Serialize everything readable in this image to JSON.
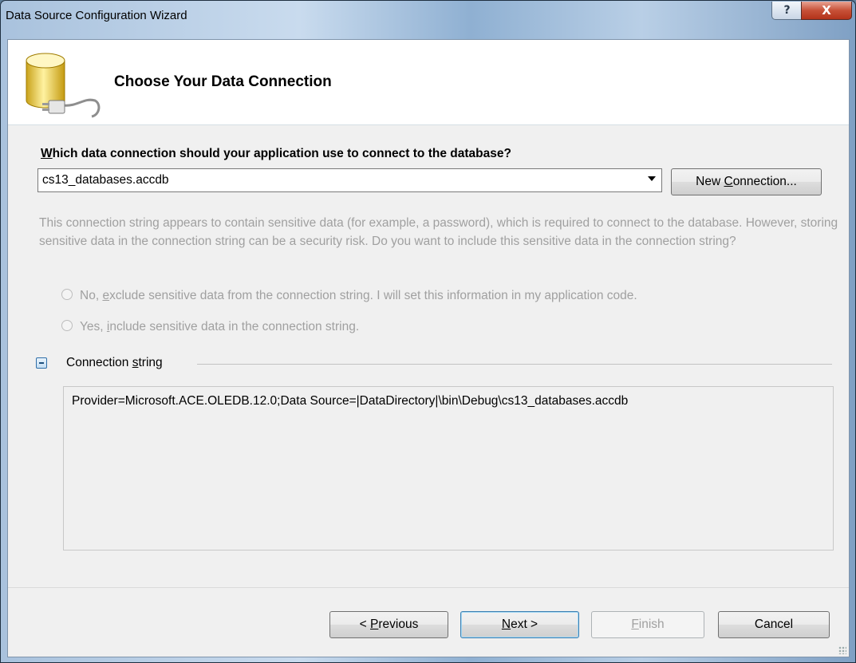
{
  "window": {
    "title": "Data Source Configuration Wizard",
    "help_glyph": "?",
    "close_glyph": "X"
  },
  "header": {
    "title": "Choose Your Data Connection",
    "icon": "database-plug-icon"
  },
  "question": {
    "mnemonic": "W",
    "rest": "hich data connection should your application use to connect to the database?"
  },
  "connection_select": {
    "value": "cs13_databases.accdb"
  },
  "new_connection_button": {
    "before": "New ",
    "mnemonic": "C",
    "after": "onnection..."
  },
  "sensitive_notice": "This connection string appears to contain sensitive data (for example, a password), which is required to connect to the database. However, storing sensitive data in the connection string can be a security risk. Do you want to include this sensitive data in the connection string?",
  "radio_exclude": {
    "before": "No, ",
    "mnemonic": "e",
    "after": "xclude sensitive data from the connection string. I will set this information in my application code."
  },
  "radio_include": {
    "before": "Yes, ",
    "mnemonic": "i",
    "after": "nclude sensitive data in the connection string."
  },
  "connection_string_section": {
    "label_before": "Connection ",
    "mnemonic": "s",
    "label_after": "tring",
    "value": "Provider=Microsoft.ACE.OLEDB.12.0;Data Source=|DataDirectory|\\bin\\Debug\\cs13_databases.accdb"
  },
  "buttons": {
    "previous": {
      "before": "< ",
      "mnemonic": "P",
      "after": "revious"
    },
    "next": {
      "before": "",
      "mnemonic": "N",
      "after": "ext >"
    },
    "finish": {
      "before": "",
      "mnemonic": "F",
      "after": "inish"
    },
    "cancel": "Cancel"
  },
  "colors": {
    "disabled_text": "#a0a0a0",
    "header_background": "#ffffff",
    "dialog_background": "#f0f0f0",
    "close_button": "#c75138"
  }
}
